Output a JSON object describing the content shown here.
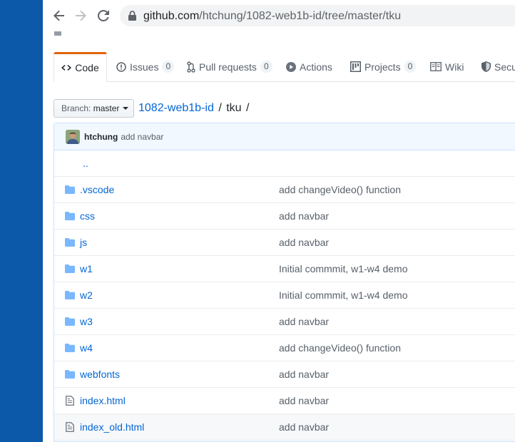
{
  "browser": {
    "url_host": "github.com",
    "url_path": "/htchung/1082-web1b-id/tree/master/tku"
  },
  "reponav": {
    "tabs": [
      {
        "label": "Code",
        "icon": "code-icon"
      },
      {
        "label": "Issues",
        "count": "0",
        "icon": "issue-icon"
      },
      {
        "label": "Pull requests",
        "count": "0",
        "icon": "pull-request-icon"
      },
      {
        "label": "Actions",
        "icon": "play-icon"
      },
      {
        "label": "Projects",
        "count": "0",
        "icon": "project-icon"
      },
      {
        "label": "Wiki",
        "icon": "book-icon"
      },
      {
        "label": "Secu",
        "icon": "shield-icon"
      }
    ]
  },
  "branch": {
    "label": "Branch:",
    "value": "master"
  },
  "breadcrumb": {
    "repo": "1082-web1b-id",
    "folder": "tku",
    "separator": "/"
  },
  "commit": {
    "author": "htchung",
    "message": "add navbar"
  },
  "files": {
    "parent": "..",
    "rows": [
      {
        "name": ".vscode",
        "type": "folder",
        "message": "add changeVideo() function"
      },
      {
        "name": "css",
        "type": "folder",
        "message": "add navbar"
      },
      {
        "name": "js",
        "type": "folder",
        "message": "add navbar"
      },
      {
        "name": "w1",
        "type": "folder",
        "message": "Initial commmit, w1-w4 demo"
      },
      {
        "name": "w2",
        "type": "folder",
        "message": "Initial commmit, w1-w4 demo"
      },
      {
        "name": "w3",
        "type": "folder",
        "message": "add navbar"
      },
      {
        "name": "w4",
        "type": "folder",
        "message": "add changeVideo() function"
      },
      {
        "name": "webfonts",
        "type": "folder",
        "message": "add navbar"
      },
      {
        "name": "index.html",
        "type": "file",
        "message": "add navbar"
      },
      {
        "name": "index_old.html",
        "type": "file",
        "message": "add navbar"
      }
    ]
  },
  "colors": {
    "link": "#0366d6",
    "folder_icon": "#79b8ff",
    "tab_accent": "#e36209",
    "desktop": "#0b59a8"
  }
}
